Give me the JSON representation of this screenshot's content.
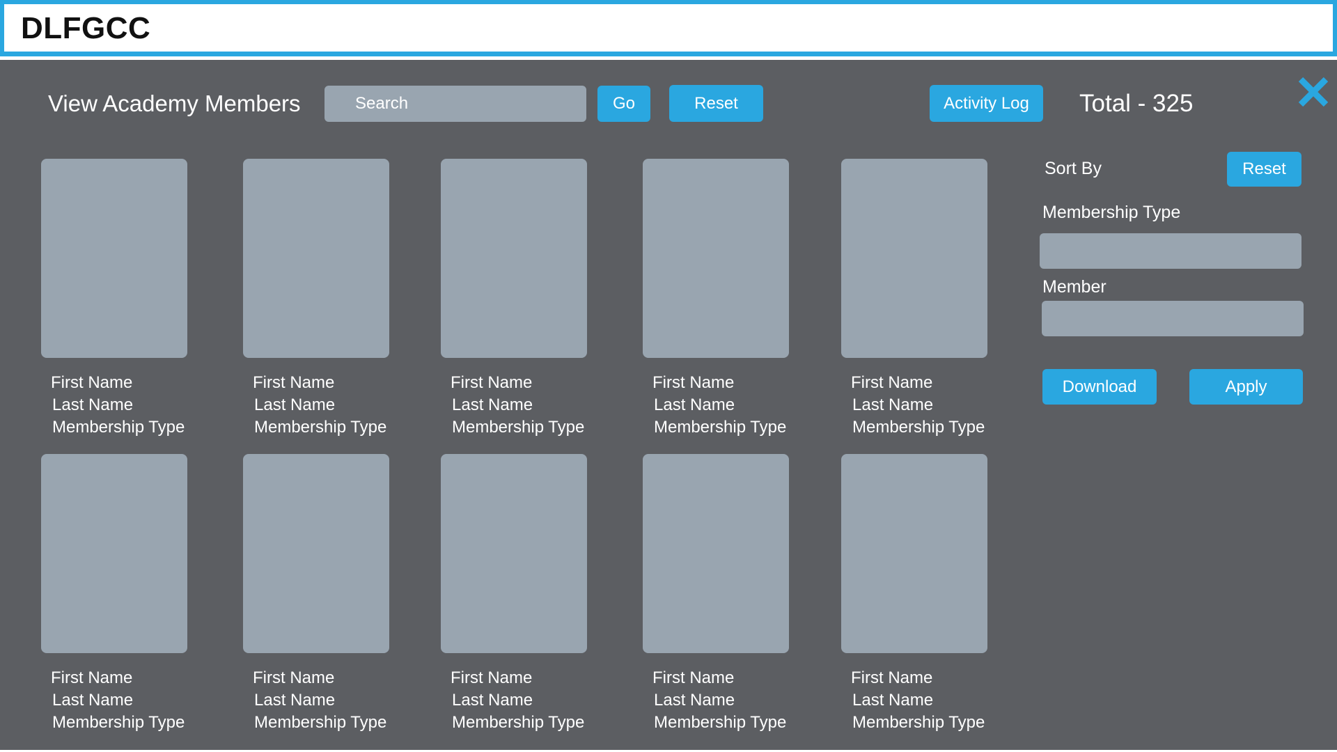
{
  "header": {
    "brand": "DLFGCC"
  },
  "toolbar": {
    "title": "View Academy Members",
    "search_placeholder": "Search",
    "go_label": "Go",
    "reset_label": "Reset",
    "activity_log_label": "Activity Log",
    "total_label": "Total - 325"
  },
  "members": [
    {
      "first": "First Name",
      "last": "Last Name",
      "type": "Membership Type"
    },
    {
      "first": "First Name",
      "last": "Last Name",
      "type": "Membership Type"
    },
    {
      "first": "First Name",
      "last": "Last Name",
      "type": "Membership Type"
    },
    {
      "first": "First Name",
      "last": "Last Name",
      "type": "Membership Type"
    },
    {
      "first": "First Name",
      "last": "Last Name",
      "type": "Membership Type"
    },
    {
      "first": "First Name",
      "last": "Last Name",
      "type": "Membership Type"
    },
    {
      "first": "First Name",
      "last": "Last Name",
      "type": "Membership Type"
    },
    {
      "first": "First Name",
      "last": "Last Name",
      "type": "Membership Type"
    },
    {
      "first": "First Name",
      "last": "Last Name",
      "type": "Membership Type"
    },
    {
      "first": "First Name",
      "last": "Last Name",
      "type": "Membership Type"
    }
  ],
  "sidebar": {
    "sort_by_label": "Sort By",
    "reset_label": "Reset",
    "membership_type_label": "Membership Type",
    "member_label": "Member",
    "download_label": "Download",
    "apply_label": "Apply"
  },
  "icons": {
    "close": "close-icon"
  },
  "colors": {
    "accent": "#2aa7e0",
    "panel_background": "#5c5e62",
    "placeholder": "#99a5b0",
    "text": "#ffffff"
  }
}
